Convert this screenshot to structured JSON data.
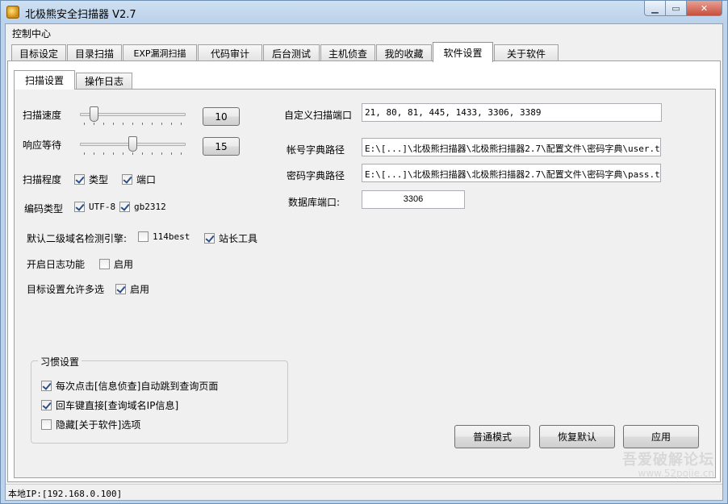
{
  "window": {
    "title": "北极熊安全扫描器 V2.7",
    "controls": {
      "minimize": "▁",
      "maximize": "▭",
      "close": "✕"
    }
  },
  "menu": {
    "items": [
      "控制中心"
    ]
  },
  "main_tabs": {
    "items": [
      "目标设定",
      "目录扫描",
      "EXP漏洞扫描",
      "代码审计",
      "后台测试",
      "主机侦查",
      "我的收藏",
      "软件设置",
      "关于软件"
    ],
    "active": "软件设置"
  },
  "sub_tabs": {
    "items": [
      "扫描设置",
      "操作日志"
    ],
    "active": "扫描设置"
  },
  "scan_settings": {
    "speed": {
      "label": "扫描速度",
      "value": "10",
      "level": 0.1
    },
    "timeout": {
      "label": "响应等待",
      "value": "15",
      "level": 0.5
    },
    "depth": {
      "label": "扫描程度",
      "options": [
        {
          "label": "类型",
          "checked": true
        },
        {
          "label": "端口",
          "checked": true
        }
      ]
    },
    "encoding": {
      "label": "编码类型",
      "options": [
        {
          "label": "UTF-8",
          "checked": true
        },
        {
          "label": "gb2312",
          "checked": true
        }
      ]
    },
    "subdomain_engine": {
      "label": "默认二级域名检测引擎:",
      "options": [
        {
          "label": "114best",
          "checked": false
        },
        {
          "label": "站长工具",
          "checked": true
        }
      ]
    },
    "log": {
      "label": "开启日志功能",
      "option": {
        "label": "启用",
        "checked": false
      }
    },
    "multi_select": {
      "label": "目标设置允许多选",
      "option": {
        "label": "启用",
        "checked": true
      }
    },
    "custom_ports": {
      "label": "自定义扫描端口",
      "value": "21, 80, 81, 445, 1433, 3306, 3389"
    },
    "user_dict": {
      "label": "帐号字典路径",
      "value": "E:\\[...]\\北极熊扫描器\\北极熊扫描器2.7\\配置文件\\密码字典\\user.txt"
    },
    "pass_dict": {
      "label": "密码字典路径",
      "value": "E:\\[...]\\北极熊扫描器\\北极熊扫描器2.7\\配置文件\\密码字典\\pass.txt"
    },
    "db_port": {
      "label": "数据库端口:",
      "value": "3306"
    }
  },
  "habits": {
    "title": "习惯设置",
    "options": [
      {
        "label": "每次点击[信息侦查]自动跳到查询页面",
        "checked": true
      },
      {
        "label": "回车键直接[查询域名IP信息]",
        "checked": true
      },
      {
        "label": "隐藏[关于软件]选项",
        "checked": false
      }
    ]
  },
  "actions": {
    "normal_mode": "普通模式",
    "restore_default": "恢复默认",
    "apply": "应用"
  },
  "status": {
    "local_ip": "本地IP:[192.168.0.100]"
  },
  "watermark": {
    "line1": "吾爱破解论坛",
    "line2": "www.52pojie.cn"
  },
  "colors": {
    "titlebar": "#bcd3ea",
    "panel": "#f0f0f0",
    "check": "#2b4f8a"
  }
}
